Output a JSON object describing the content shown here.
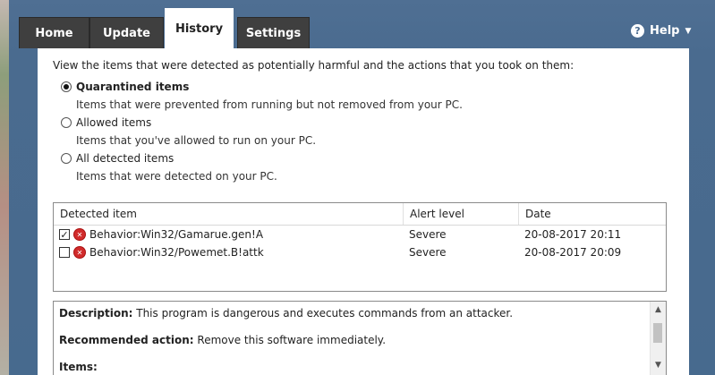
{
  "tabs": [
    {
      "label": "Home"
    },
    {
      "label": "Update"
    },
    {
      "label": "History"
    },
    {
      "label": "Settings"
    }
  ],
  "active_tab": "History",
  "help": {
    "icon": "help-circle-icon",
    "label": "Help"
  },
  "intro_text": "View the items that were detected as potentially harmful and the actions that you took on them:",
  "options": [
    {
      "label": "Quarantined items",
      "description": "Items that were prevented from running but not removed from your PC.",
      "selected": true
    },
    {
      "label": "Allowed items",
      "description": "Items that you've allowed to run on your PC.",
      "selected": false
    },
    {
      "label": "All detected items",
      "description": "Items that were detected on your PC.",
      "selected": false
    }
  ],
  "table": {
    "columns": [
      "Detected item",
      "Alert level",
      "Date"
    ],
    "rows": [
      {
        "checked": true,
        "item": "Behavior:Win32/Gamarue.gen!A",
        "alert": "Severe",
        "date": "20-08-2017 20:11"
      },
      {
        "checked": false,
        "item": "Behavior:Win32/Powemet.B!attk",
        "alert": "Severe",
        "date": "20-08-2017 20:09"
      }
    ]
  },
  "details": {
    "description_label": "Description:",
    "description_text": "This program is dangerous and executes commands from an attacker.",
    "action_label": "Recommended action:",
    "action_text": "Remove this software immediately.",
    "items_label": "Items:"
  },
  "colors": {
    "frame": "#4a6b8f",
    "tab_dark": "#3f3f3f",
    "threat_red": "#d12b2b"
  }
}
